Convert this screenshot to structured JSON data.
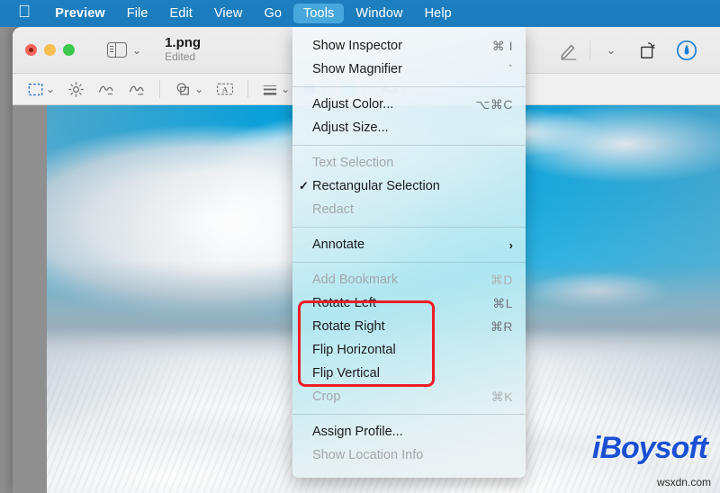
{
  "menubar": {
    "apple_icon": "apple-logo",
    "items": [
      {
        "label": "Preview",
        "bold": true,
        "active": false
      },
      {
        "label": "File",
        "bold": false,
        "active": false
      },
      {
        "label": "Edit",
        "bold": false,
        "active": false
      },
      {
        "label": "View",
        "bold": false,
        "active": false
      },
      {
        "label": "Go",
        "bold": false,
        "active": false
      },
      {
        "label": "Tools",
        "bold": false,
        "active": true
      },
      {
        "label": "Window",
        "bold": false,
        "active": false
      },
      {
        "label": "Help",
        "bold": false,
        "active": false
      }
    ]
  },
  "window": {
    "traffic_lights": [
      "close-button",
      "minimize-button",
      "maximize-button"
    ],
    "sidebar_toggle_icon": "sidebar-icon",
    "sidebar_chevron": "⌄",
    "title": "1.png",
    "subtitle": "Edited",
    "toolbar_right": [
      {
        "icon": "markup-pen-icon"
      },
      {
        "icon": "chevron-down-icon"
      },
      {
        "icon": "rotate-icon"
      },
      {
        "icon": "share-badge-icon"
      }
    ],
    "markup_tools": [
      {
        "icon": "rectangular-selection-icon",
        "chevron": "⌄",
        "selected": true
      },
      {
        "icon": "instant-alpha-icon",
        "chevron": "",
        "selected": false
      },
      {
        "icon": "sketch-icon",
        "chevron": "",
        "selected": false
      },
      {
        "icon": "draw-icon",
        "chevron": "",
        "selected": false
      },
      {
        "icon": "shapes-icon",
        "chevron": "⌄",
        "selected": false
      },
      {
        "icon": "text-icon",
        "chevron": "",
        "selected": false
      },
      {
        "icon": "shape-style-icon",
        "chevron": "⌄",
        "selected": false
      },
      {
        "icon": "border-color-icon",
        "chevron": "⌄",
        "selected": false
      }
    ],
    "fill_color": "#2fe4e4",
    "fill_chevron": "⌄",
    "text_style_label": "Aa",
    "text_style_chevron": "⌄"
  },
  "canvas": {
    "image_description": "snowy-mountain-photo",
    "watermark": "iBoysoft",
    "watermark_color": "#1a4fd6",
    "site_text": "wsxdn.com"
  },
  "tools_menu": {
    "groups": [
      {
        "items": [
          {
            "label": "Show Inspector",
            "shortcut": "⌘ I",
            "disabled": false,
            "checked": false,
            "submenu": false
          },
          {
            "label": "Show Magnifier",
            "shortcut": "`",
            "disabled": false,
            "checked": false,
            "submenu": false
          }
        ]
      },
      {
        "items": [
          {
            "label": "Adjust Color...",
            "shortcut": "⌥⌘C",
            "disabled": false,
            "checked": false,
            "submenu": false
          },
          {
            "label": "Adjust Size...",
            "shortcut": "",
            "disabled": false,
            "checked": false,
            "submenu": false
          }
        ]
      },
      {
        "items": [
          {
            "label": "Text Selection",
            "shortcut": "",
            "disabled": true,
            "checked": false,
            "submenu": false
          },
          {
            "label": "Rectangular Selection",
            "shortcut": "",
            "disabled": false,
            "checked": true,
            "submenu": false
          },
          {
            "label": "Redact",
            "shortcut": "",
            "disabled": true,
            "checked": false,
            "submenu": false
          }
        ]
      },
      {
        "items": [
          {
            "label": "Annotate",
            "shortcut": "",
            "disabled": false,
            "checked": false,
            "submenu": true
          }
        ]
      },
      {
        "items": [
          {
            "label": "Add Bookmark",
            "shortcut": "⌘D",
            "disabled": true,
            "checked": false,
            "submenu": false
          },
          {
            "label": "Rotate Left",
            "shortcut": "⌘L",
            "disabled": false,
            "checked": false,
            "submenu": false
          },
          {
            "label": "Rotate Right",
            "shortcut": "⌘R",
            "disabled": false,
            "checked": false,
            "submenu": false
          },
          {
            "label": "Flip Horizontal",
            "shortcut": "",
            "disabled": false,
            "checked": false,
            "submenu": false
          },
          {
            "label": "Flip Vertical",
            "shortcut": "",
            "disabled": false,
            "checked": false,
            "submenu": false
          },
          {
            "label": "Crop",
            "shortcut": "⌘K",
            "disabled": true,
            "checked": false,
            "submenu": false
          }
        ]
      },
      {
        "items": [
          {
            "label": "Assign Profile...",
            "shortcut": "",
            "disabled": false,
            "checked": false,
            "submenu": false
          },
          {
            "label": "Show Location Info",
            "shortcut": "",
            "disabled": true,
            "checked": false,
            "submenu": false
          }
        ]
      }
    ],
    "highlight_color": "#ee1c25"
  }
}
